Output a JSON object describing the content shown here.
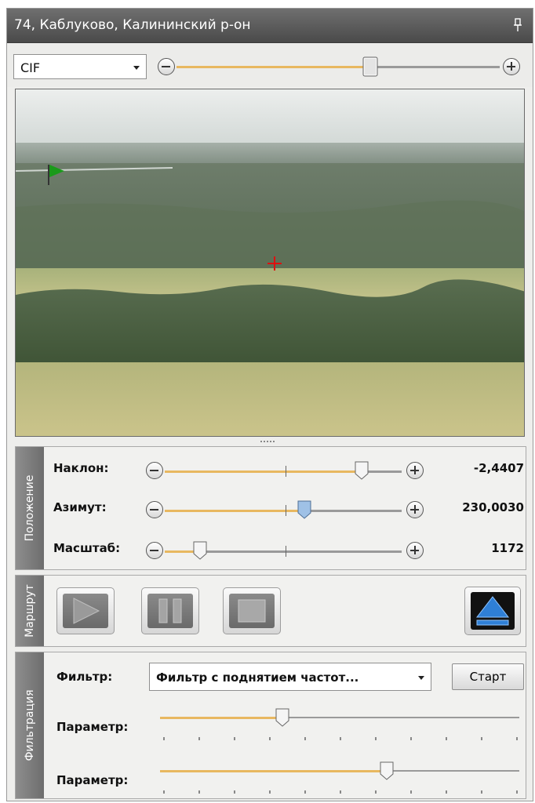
{
  "window": {
    "title": "74, Каблуково, Калининский р-он"
  },
  "toolbar": {
    "resolution_value": "CIF",
    "zoom_level": 0.6
  },
  "position_panel": {
    "tab_label": "Положение",
    "rows": [
      {
        "label": "Наклон:",
        "value": "-2,4407",
        "level": 0.83
      },
      {
        "label": "Азимут:",
        "value": "230,0030",
        "level": 0.59
      },
      {
        "label": "Масштаб:",
        "value": "1172",
        "level": 0.15
      }
    ]
  },
  "route_panel": {
    "tab_label": "Маршрут"
  },
  "filter_panel": {
    "tab_label": "Фильтрация",
    "filter_label": "Фильтр:",
    "filter_value": "Фильтр с поднятием частот...",
    "start_label": "Старт",
    "params": [
      {
        "label": "Параметр:",
        "level": 0.34
      },
      {
        "label": "Параметр:",
        "level": 0.63
      }
    ]
  },
  "colors": {
    "accent": "#e8b860",
    "titlebar": "#555555",
    "eject": "#2f7fd6"
  }
}
